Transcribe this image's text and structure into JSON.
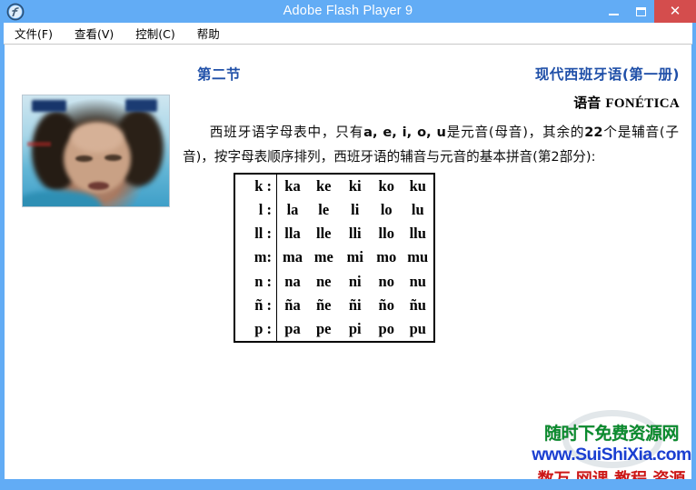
{
  "window": {
    "title": "Adobe Flash Player 9",
    "icon": "flash-player-icon",
    "controls": {
      "minimize": "–",
      "maximize": "▢",
      "close": "✕"
    },
    "accent_blue": "#62acf5",
    "close_red": "#d44d4d"
  },
  "menu": {
    "items": [
      {
        "label": "文件(F)"
      },
      {
        "label": "查看(V)"
      },
      {
        "label": "控制(C)"
      },
      {
        "label": "帮助"
      }
    ]
  },
  "slide": {
    "header_left": "第二节",
    "header_right": "现代西班牙语(第一册)",
    "subheader_cn": "语音 ",
    "subheader_latin": "FONÉTICA",
    "header_color": "#1f4fa8",
    "paragraph": {
      "part1": "西班牙语字母表中，只有",
      "vowels": "a, e, i, o, u",
      "part2": "是元音(母音)，其余的",
      "count": "22",
      "part3": "个是辅音(子音)，按字母表顺序排列，西班牙语的辅音与元音的基本拼音(第2部分):"
    },
    "table": {
      "rows": [
        {
          "label": "k :",
          "cells": [
            "ka",
            "ke",
            "ki",
            "ko",
            "ku"
          ]
        },
        {
          "label": "l :",
          "cells": [
            "la",
            "le",
            "li",
            "lo",
            "lu"
          ]
        },
        {
          "label": "ll :",
          "cells": [
            "lla",
            "lle",
            "lli",
            "llo",
            "llu"
          ]
        },
        {
          "label": "m:",
          "cells": [
            "ma",
            "me",
            "mi",
            "mo",
            "mu"
          ]
        },
        {
          "label": "n :",
          "cells": [
            "na",
            "ne",
            "ni",
            "no",
            "nu"
          ]
        },
        {
          "label": "ñ :",
          "cells": [
            "ña",
            "ñe",
            "ñi",
            "ño",
            "ñu"
          ]
        },
        {
          "label": "p :",
          "cells": [
            "pa",
            "pe",
            "pi",
            "po",
            "pu"
          ]
        }
      ]
    }
  },
  "video": {
    "description": "webcam-lecturer-video"
  },
  "watermark": {
    "line1": "随时下免费资源网",
    "line2": "www.SuiShiXia.com",
    "line3": "数万 网课 教程 资源",
    "color1": "#0b8b2e",
    "color2": "#1b3fd1",
    "color3": "#cc1717"
  }
}
